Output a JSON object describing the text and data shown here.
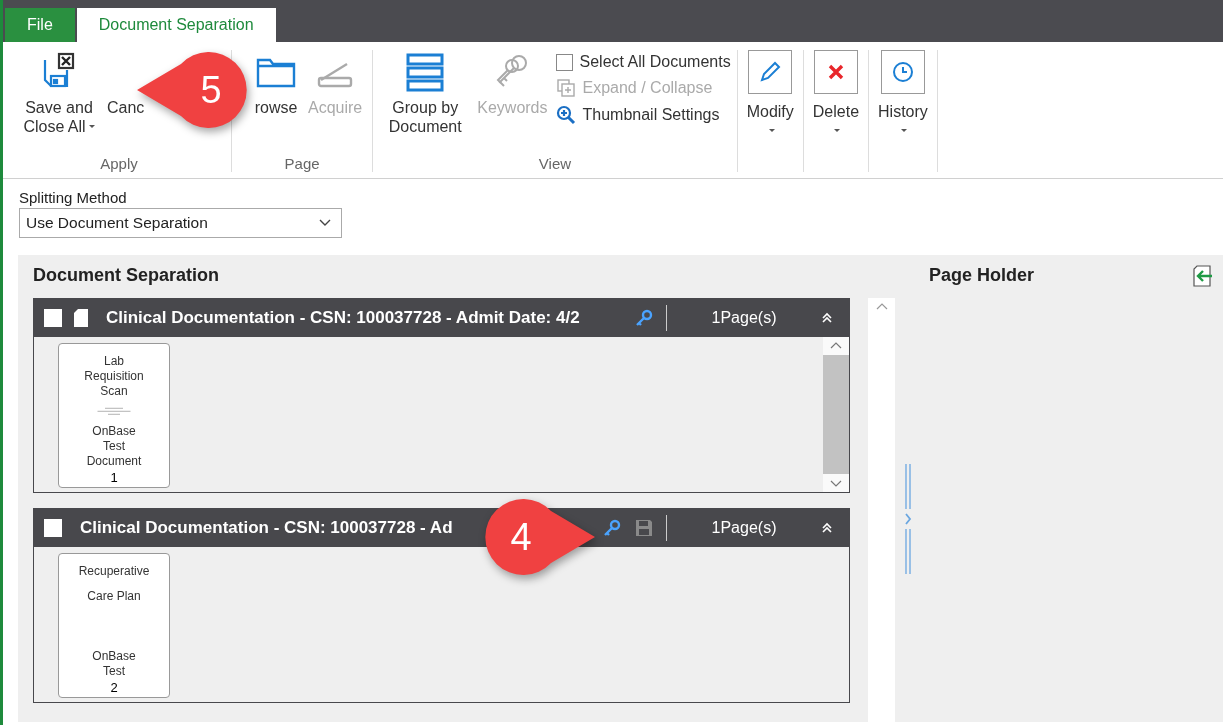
{
  "tabs": [
    {
      "label": "File",
      "selected": false
    },
    {
      "label": "Document Separation",
      "selected": true
    }
  ],
  "ribbon": {
    "groups": [
      {
        "label": "Apply",
        "items": [
          {
            "kind": "large",
            "label": "Save and Close All",
            "dropdown": true,
            "disabled": false
          },
          {
            "kind": "large",
            "label": "Canc",
            "dropdown": false,
            "disabled": false
          }
        ]
      },
      {
        "label": "Page",
        "items": [
          {
            "kind": "large",
            "label": "rowse",
            "dropdown": false,
            "disabled": false
          },
          {
            "kind": "large",
            "label": "Acquire",
            "dropdown": false,
            "disabled": true
          }
        ]
      },
      {
        "label": "View",
        "items": [
          {
            "kind": "large",
            "label": "Group by Document",
            "dropdown": false,
            "disabled": false
          },
          {
            "kind": "large",
            "label": "Keywords",
            "dropdown": false,
            "disabled": true
          },
          {
            "kind": "list",
            "rows": [
              {
                "kind": "checkbox",
                "label": "Select All Documents",
                "checked": false,
                "disabled": false
              },
              {
                "kind": "command",
                "label": "Expand / Collapse",
                "disabled": true
              },
              {
                "kind": "command",
                "label": "Thumbnail Settings",
                "disabled": false
              }
            ]
          }
        ]
      },
      {
        "items": [
          {
            "kind": "boxed",
            "label": "Modify",
            "dropdown": true,
            "disabled": false
          }
        ]
      },
      {
        "items": [
          {
            "kind": "boxed",
            "label": "Delete",
            "dropdown": true,
            "disabled": false
          }
        ]
      },
      {
        "items": [
          {
            "kind": "boxed",
            "label": "History",
            "dropdown": true,
            "disabled": false
          }
        ]
      }
    ]
  },
  "splitting": {
    "label": "Splitting Method",
    "value": "Use Document Separation"
  },
  "separation": {
    "title": "Document Separation",
    "documents": [
      {
        "title": "Clinical Documentation - CSN: 100037728 - Admit Date: 4/2",
        "checked": false,
        "page_icon": true,
        "modified": false,
        "pages": "1Page(s)",
        "expanded": true,
        "scrollable": true,
        "thumbnails": [
          {
            "title_lines": [
              "Lab Requisition Scan"
            ],
            "fine_print": true,
            "bottom_lines": [
              "OnBase",
              "Test Document"
            ],
            "number": "1"
          }
        ]
      },
      {
        "title": "Clinical Documentation - CSN: 100037728 - Ad",
        "checked": false,
        "page_icon": false,
        "modified": true,
        "pages": "1Page(s)",
        "expanded": true,
        "scrollable": false,
        "thumbnails": [
          {
            "title_lines": [
              "Recuperative",
              "Care Plan"
            ],
            "fine_print": false,
            "bottom_lines": [
              "OnBase",
              "Test"
            ],
            "number": "2"
          }
        ]
      }
    ]
  },
  "page_holder": {
    "title": "Page Holder"
  },
  "callouts": [
    {
      "number": "5"
    },
    {
      "number": "4"
    }
  ]
}
